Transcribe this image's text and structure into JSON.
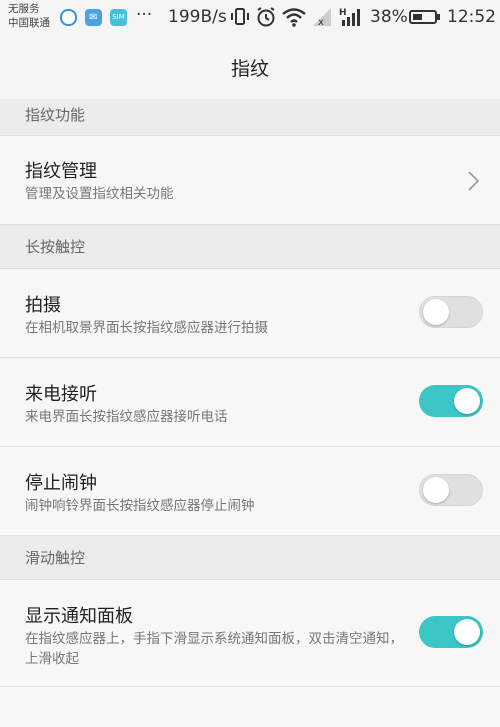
{
  "status_bar": {
    "carrier_line1": "无服务",
    "carrier_line2": "中国联通",
    "app_icons": [
      "browser-icon",
      "message-icon",
      "app-icon"
    ],
    "dots": "···",
    "speed": "199B/s",
    "battery_percent": "38%",
    "time": "12:52",
    "battery_level": 0.38
  },
  "header": {
    "title": "指纹"
  },
  "sections": [
    {
      "header": "指纹功能"
    },
    {
      "header": "长按触控"
    },
    {
      "header": "滑动触控"
    }
  ],
  "rows": [
    {
      "title": "指纹管理",
      "subtitle": "管理及设置指纹相关功能",
      "control": "chevron"
    },
    {
      "title": "拍摄",
      "subtitle": "在相机取景界面长按指纹感应器进行拍摄",
      "control": "toggle",
      "on": false
    },
    {
      "title": "来电接听",
      "subtitle": "来电界面长按指纹感应器接听电话",
      "control": "toggle",
      "on": true
    },
    {
      "title": "停止闹钟",
      "subtitle": "闹钟响铃界面长按指纹感应器停止闹钟",
      "control": "toggle",
      "on": false
    },
    {
      "title": "显示通知面板",
      "subtitle": "在指纹感应器上，手指下滑显示系统通知面板，双击清空通知，上滑收起",
      "control": "toggle",
      "on": true
    }
  ],
  "colors": {
    "accent": "#3bc5c5",
    "toggle_off": "#e0e0e0",
    "background": "#f5f5f5"
  }
}
